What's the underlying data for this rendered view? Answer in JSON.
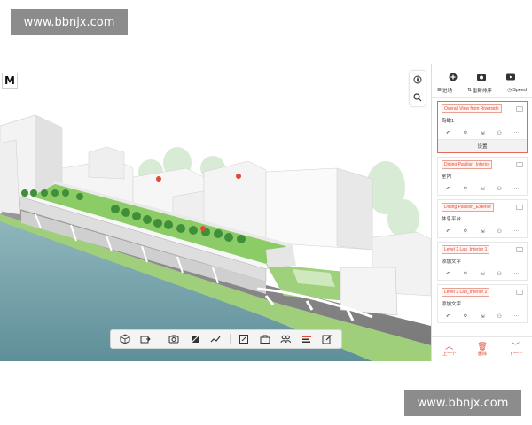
{
  "watermarks": {
    "top": "www.bbnjx.com",
    "bottom": "www.bbnjx.com"
  },
  "app": {
    "logo": "M"
  },
  "panel": {
    "tabs": [
      {
        "label": "进场"
      },
      {
        "label": "重新排序"
      },
      {
        "label": "Speed"
      }
    ],
    "views": [
      {
        "title": "Overall View from Riverside",
        "subtitle": "鸟瞰1",
        "setting_label": "设置",
        "active": true
      },
      {
        "title": "Dining Pavilion_Interior",
        "subtitle": "室内",
        "active": false
      },
      {
        "title": "Dining Pavilion_Exterior",
        "subtitle": "休息平台",
        "active": false
      },
      {
        "title": "Level 2 Lab_Interior 1",
        "subtitle": "添加文字",
        "active": false
      },
      {
        "title": "Level 2 Lab_Interior 2",
        "subtitle": "添加文字",
        "active": false
      }
    ],
    "footer": {
      "prev": "上一个",
      "delete": "删除",
      "next": "下一个"
    }
  },
  "colors": {
    "accent": "#e04a36",
    "water": "#6d9aa3",
    "grass": "#7cc35c",
    "building": "#f2f2f2",
    "sky": "#ffffff"
  },
  "icons": {
    "panel_top": [
      "add-icon",
      "camera-icon",
      "video-icon"
    ],
    "toolbar": [
      "cube-icon",
      "export-icon",
      "camera-icon",
      "section-icon",
      "measure-icon",
      "markup-icon",
      "briefcase-icon",
      "people-icon",
      "timeline-icon",
      "edit-icon"
    ]
  }
}
